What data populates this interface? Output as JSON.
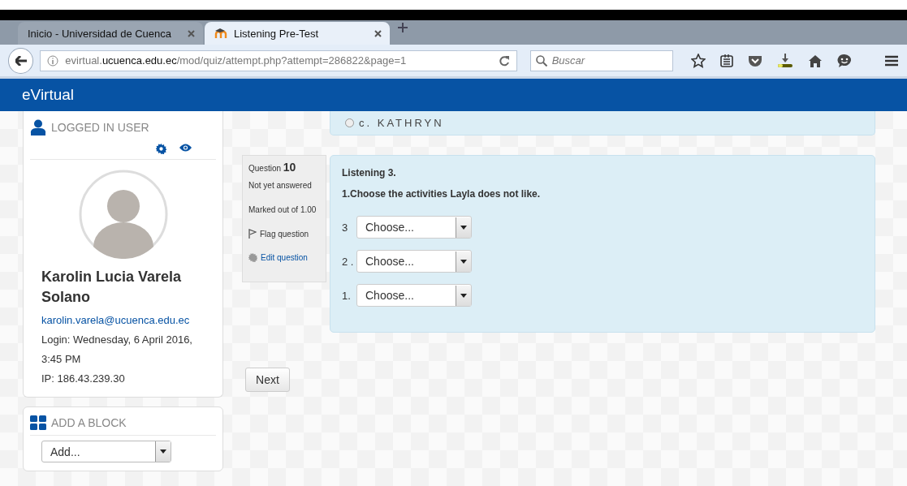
{
  "browser": {
    "tabs": [
      {
        "label": "Inicio - Universidad de Cuenca",
        "selected": false
      },
      {
        "label": "Listening Pre-Test",
        "selected": true
      }
    ],
    "address": {
      "host_prefix": "evirtual.",
      "domain": "ucuenca.edu.ec",
      "path": "/mod/quiz/attempt.php?attempt=286822&page=1"
    },
    "search": {
      "placeholder": "Buscar"
    }
  },
  "site": {
    "title": "eVirtual"
  },
  "user_block": {
    "title": "LOGGED IN USER",
    "name": "Karolin Lucia Varela Solano",
    "email": "karolin.varela@ucuenca.edu.ec",
    "login": "Login: Wednesday, 6 April 2016, 3:45 PM",
    "ip": "IP: 186.43.239.30"
  },
  "add_block": {
    "title": "ADD A BLOCK",
    "select": "Add..."
  },
  "previous_question": {
    "option": {
      "label": "c. KATHRYN",
      "selected": false
    }
  },
  "question": {
    "label": "Question",
    "number": "10",
    "status": "Not yet answered",
    "marks": "Marked out of 1.00",
    "flag": "Flag question",
    "edit": "Edit question",
    "title": "Listening 3.",
    "prompt": "1.Choose the activities Layla does not like.",
    "items": [
      {
        "label": "3",
        "select": "Choose..."
      },
      {
        "label": "2 .",
        "select": "Choose..."
      },
      {
        "label": "1.",
        "select": "Choose..."
      }
    ]
  },
  "next_button": "Next"
}
